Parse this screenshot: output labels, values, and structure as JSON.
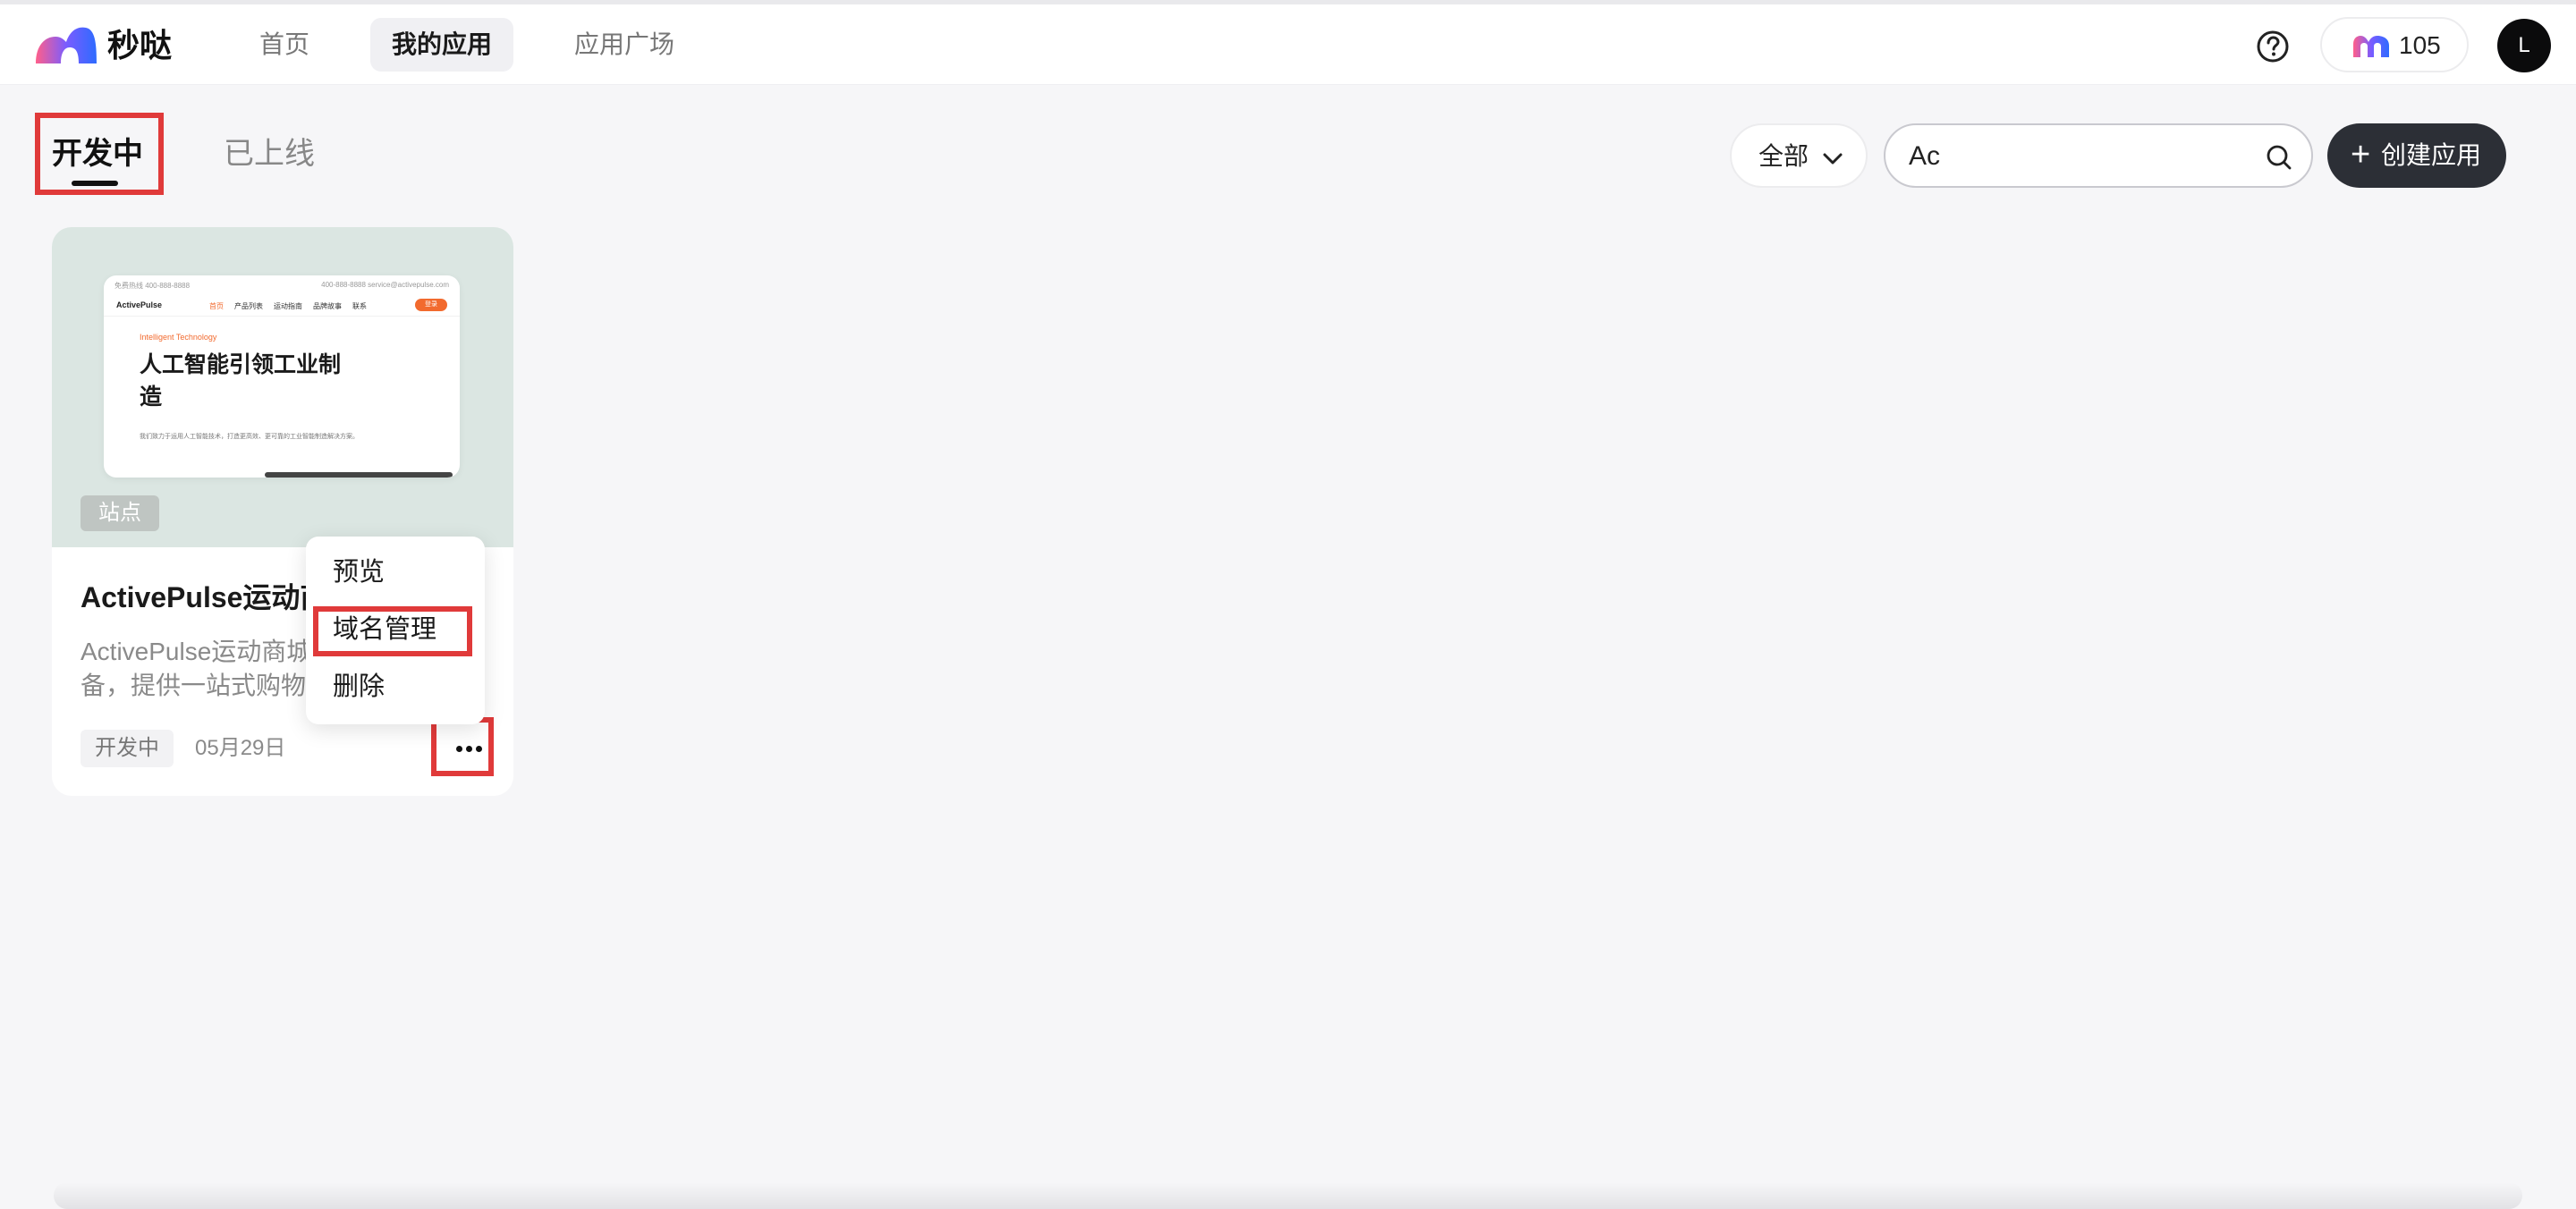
{
  "header": {
    "brand": "秒哒",
    "nav": [
      "首页",
      "我的应用",
      "应用广场"
    ],
    "active_nav": "我的应用",
    "credits": "105",
    "avatar_initial": "L"
  },
  "tabs": {
    "development": "开发中",
    "online": "已上线"
  },
  "toolbar": {
    "filter_label": "全部",
    "search_value": "Ac",
    "create_label": "创建应用"
  },
  "card": {
    "preview": {
      "top_left": "免费热线 400-888-8888",
      "top_right": "400-888-8888    service@activepulse.com",
      "brand": "ActivePulse",
      "nav": [
        "首页",
        "产品列表",
        "运动指南",
        "品牌故事",
        "联系"
      ],
      "login": "登录",
      "eyebrow": "Intelligent Technology",
      "headline": "人工智能引领工业制造",
      "desc": "我们致力于运用人工智能技术，打造更高效、更可靠的工业智能制造解决方案。"
    },
    "type_badge": "站点",
    "title": "ActivePulse运动商",
    "desc_line1": "ActivePulse运动商城",
    "desc_line2": "备，提供一站式购物",
    "status": "开发中",
    "date": "05月29日"
  },
  "menu": {
    "items": [
      "预览",
      "域名管理",
      "删除"
    ]
  },
  "colors": {
    "accent": "#2c2f36",
    "highlight": "#e03a3a",
    "preview_accent": "#f26a2e"
  }
}
